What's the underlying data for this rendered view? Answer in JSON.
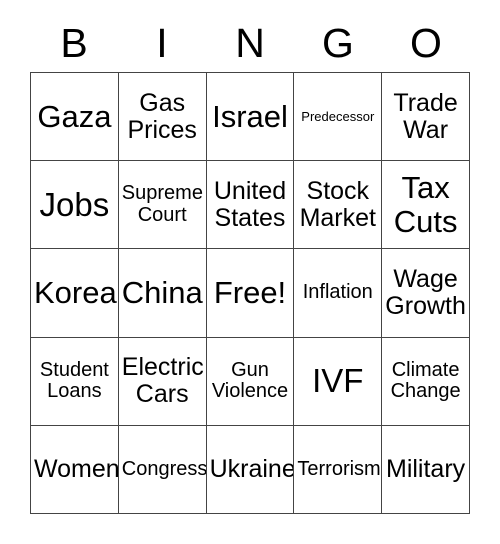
{
  "card": {
    "header": {
      "letters": [
        "B",
        "I",
        "N",
        "G",
        "O"
      ]
    },
    "grid": {
      "rows": 5,
      "columns": 5,
      "free_space_index": 12,
      "border_color": "#444444",
      "text_color": "#000000",
      "background_color": "#ffffff",
      "cells": [
        {
          "label": "Gaza",
          "size": "lg"
        },
        {
          "label": "Gas\nPrices",
          "size": "md"
        },
        {
          "label": "Israel",
          "size": "lg"
        },
        {
          "label": "Predecessor",
          "size": "xxs"
        },
        {
          "label": "Trade\nWar",
          "size": "md"
        },
        {
          "label": "Jobs",
          "size": "xl"
        },
        {
          "label": "Supreme\nCourt",
          "size": "sm"
        },
        {
          "label": "United\nStates",
          "size": "md"
        },
        {
          "label": "Stock\nMarket",
          "size": "md"
        },
        {
          "label": "Tax\nCuts",
          "size": "lg"
        },
        {
          "label": "Korea",
          "size": "lg"
        },
        {
          "label": "China",
          "size": "lg"
        },
        {
          "label": "Free!",
          "size": "lg"
        },
        {
          "label": "Inflation",
          "size": "sm"
        },
        {
          "label": "Wage\nGrowth",
          "size": "md"
        },
        {
          "label": "Student\nLoans",
          "size": "sm"
        },
        {
          "label": "Electric\nCars",
          "size": "md"
        },
        {
          "label": "Gun\nViolence",
          "size": "sm"
        },
        {
          "label": "IVF",
          "size": "xl"
        },
        {
          "label": "Climate\nChange",
          "size": "sm"
        },
        {
          "label": "Women",
          "size": "md"
        },
        {
          "label": "Congress",
          "size": "sm"
        },
        {
          "label": "Ukraine",
          "size": "md"
        },
        {
          "label": "Terrorism",
          "size": "sm"
        },
        {
          "label": "Military",
          "size": "md"
        }
      ]
    }
  }
}
